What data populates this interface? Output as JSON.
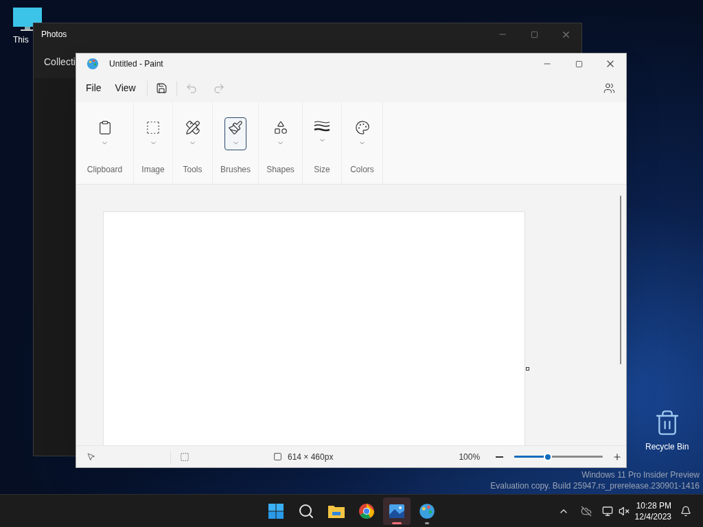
{
  "desktop_icons": [
    {
      "kind": "computer",
      "label": "This"
    },
    {
      "kind": "recycle",
      "label": "Recycle Bin"
    }
  ],
  "photos_window": {
    "title": "Photos",
    "nav_item": "Collecti"
  },
  "paint_window": {
    "title": "Untitled - Paint",
    "menu": [
      "File",
      "View"
    ],
    "ribbon_groups": [
      {
        "label": "Clipboard",
        "selected": false
      },
      {
        "label": "Image",
        "selected": false
      },
      {
        "label": "Tools",
        "selected": false
      },
      {
        "label": "Brushes",
        "selected": true
      },
      {
        "label": "Shapes",
        "selected": false
      },
      {
        "label": "Size",
        "selected": false
      },
      {
        "label": "Colors",
        "selected": false
      }
    ],
    "status_bar": {
      "canvas_size": "614 × 460px",
      "zoom": "100%",
      "zoom_slider": {
        "level": 0.38
      }
    }
  },
  "watermark_lines": [
    "Windows 11 Pro Insider Preview",
    "Evaluation copy. Build 25947.rs_prerelease.230901-1416"
  ],
  "taskbar": {
    "items": [
      {
        "kind": "start",
        "running": false,
        "selected": false
      },
      {
        "kind": "search",
        "running": false,
        "selected": false
      },
      {
        "kind": "explorer",
        "running": false,
        "selected": false
      },
      {
        "kind": "browser",
        "running": false,
        "selected": false
      },
      {
        "kind": "photos",
        "running": true,
        "selected": true
      },
      {
        "kind": "paint",
        "running": true,
        "selected": false
      }
    ],
    "clock": {
      "time": "10:28 PM",
      "date": "12/4/2023"
    }
  }
}
